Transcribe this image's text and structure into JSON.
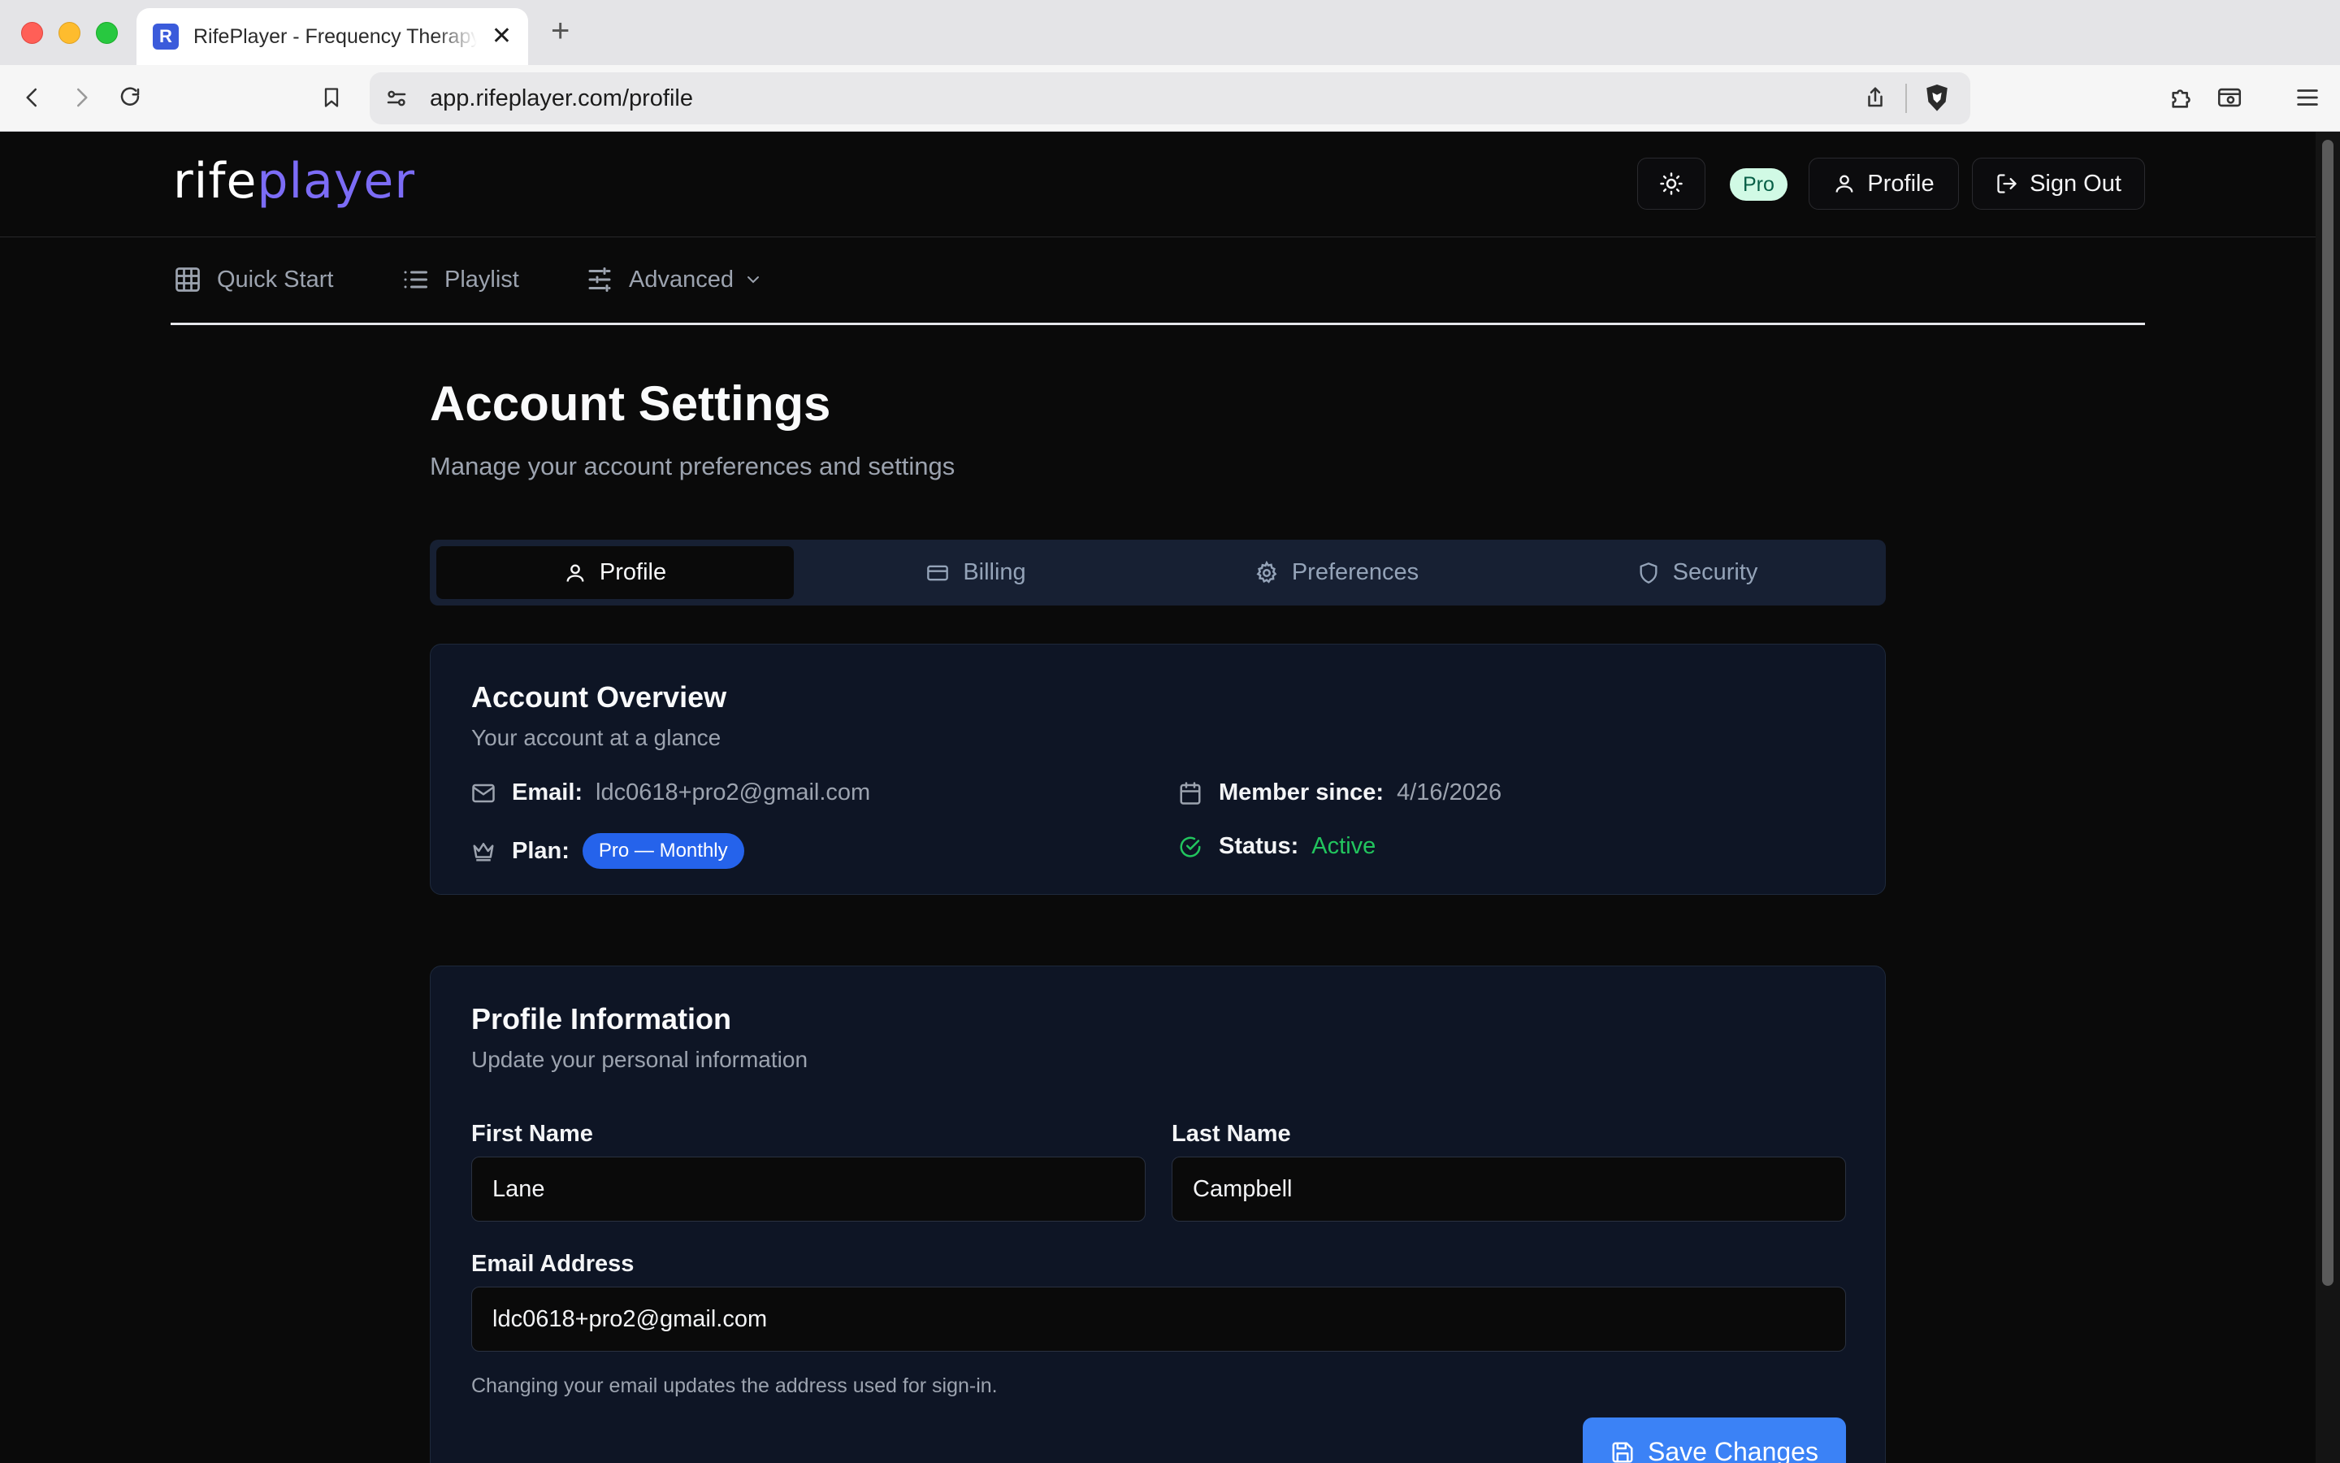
{
  "browser": {
    "tab_title": "RifePlayer - Frequency Therapy",
    "favicon_letter": "R",
    "url": "app.rifeplayer.com/profile"
  },
  "header": {
    "logo_part1": "rife",
    "logo_part2": "player",
    "plan_badge": "Pro",
    "profile_label": "Profile",
    "signout_label": "Sign Out"
  },
  "nav": {
    "items": [
      {
        "label": "Quick Start",
        "icon": "grid-icon"
      },
      {
        "label": "Playlist",
        "icon": "list-icon"
      },
      {
        "label": "Advanced",
        "icon": "sliders-icon"
      }
    ]
  },
  "page": {
    "title": "Account Settings",
    "subtitle": "Manage your account preferences and settings"
  },
  "tabs": [
    {
      "label": "Profile",
      "icon": "user-icon",
      "active": true
    },
    {
      "label": "Billing",
      "icon": "credit-card-icon",
      "active": false
    },
    {
      "label": "Preferences",
      "icon": "gear-icon",
      "active": false
    },
    {
      "label": "Security",
      "icon": "shield-icon",
      "active": false
    }
  ],
  "overview": {
    "title": "Account Overview",
    "subtitle": "Your account at a glance",
    "email_label": "Email:",
    "email_value": "ldc0618+pro2@gmail.com",
    "member_label": "Member since:",
    "member_value": "4/16/2026",
    "plan_label": "Plan:",
    "plan_value": "Pro — Monthly",
    "status_label": "Status:",
    "status_value": "Active"
  },
  "profile_form": {
    "title": "Profile Information",
    "subtitle": "Update your personal information",
    "first_name_label": "First Name",
    "first_name_value": "Lane",
    "last_name_label": "Last Name",
    "last_name_value": "Campbell",
    "email_label": "Email Address",
    "email_value": "ldc0618+pro2@gmail.com",
    "email_hint": "Changing your email updates the address used for sign-in.",
    "save_label": "Save Changes"
  },
  "colors": {
    "accent": "#3b82f6",
    "logo_accent": "#7c6cf6",
    "status_active": "#22c55e",
    "pro_badge_bg": "#d1fae5"
  }
}
